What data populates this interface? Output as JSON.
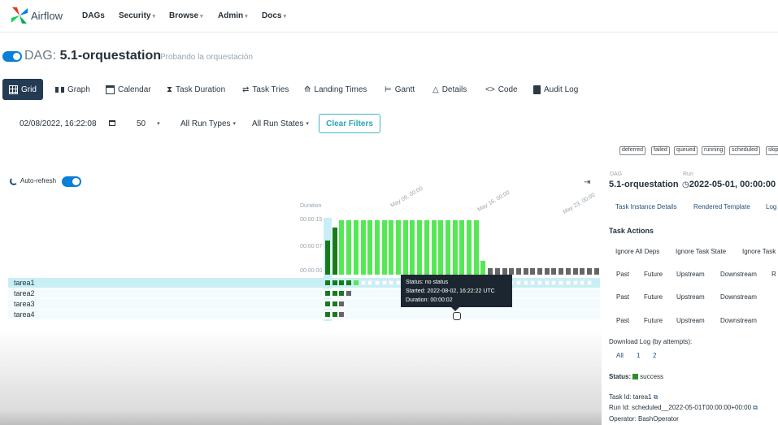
{
  "nav": {
    "brand": "Airflow",
    "items": [
      {
        "label": "DAGs",
        "has_menu": false
      },
      {
        "label": "Security",
        "has_menu": true
      },
      {
        "label": "Browse",
        "has_menu": true
      },
      {
        "label": "Admin",
        "has_menu": true
      },
      {
        "label": "Docs",
        "has_menu": true
      }
    ]
  },
  "dag": {
    "label": "DAG:",
    "name": "5.1-orquestation",
    "description": "Probando la orquestación",
    "paused": false
  },
  "tabs": [
    {
      "label": "Grid",
      "icon": "grid-icon",
      "active": true
    },
    {
      "label": "Graph",
      "icon": "graph-icon"
    },
    {
      "label": "Calendar",
      "icon": "calendar-icon"
    },
    {
      "label": "Task Duration",
      "icon": "hourglass-icon"
    },
    {
      "label": "Task Tries",
      "icon": "retry-icon"
    },
    {
      "label": "Landing Times",
      "icon": "landing-icon"
    },
    {
      "label": "Gantt",
      "icon": "gantt-icon"
    },
    {
      "label": "Details",
      "icon": "warning-icon"
    },
    {
      "label": "Code",
      "icon": "code-icon"
    },
    {
      "label": "Audit Log",
      "icon": "document-icon"
    }
  ],
  "filters": {
    "base_date": "02/08/2022, 16:22:08",
    "num_runs": "50",
    "run_types": "All Run Types",
    "run_states": "All Run States",
    "clear_label": "Clear Filters"
  },
  "legend": [
    {
      "label": "deferred",
      "color": "#8a4fc2"
    },
    {
      "label": "failed",
      "color": "#c0203a"
    },
    {
      "label": "queued",
      "color": "#7a7a7a"
    },
    {
      "label": "running",
      "color": "#55e855"
    },
    {
      "label": "scheduled",
      "color": "#c9b88a"
    },
    {
      "label": "skip",
      "color": "#e05fe0"
    }
  ],
  "grid": {
    "auto_refresh_label": "Auto-refresh",
    "auto_refresh_on": true,
    "duration_label": "Duration",
    "duration_ticks": [
      "00:00:15",
      "00:00:07",
      "00:00:00"
    ],
    "date_ticks": [
      "May 09, 00:00",
      "May 16, 00:00",
      "May 23, 00:00"
    ],
    "colors": {
      "success": "#1a7a1a",
      "running": "#55e855",
      "no_status": "#666666",
      "selected": "#c8eff6"
    },
    "runs": [
      {
        "duration": 0.6,
        "state": "success",
        "selected": true
      },
      {
        "duration": 0.83,
        "state": "success"
      },
      {
        "duration": 0.95,
        "state": "running"
      },
      {
        "duration": 0.95,
        "state": "running"
      },
      {
        "duration": 0.95,
        "state": "running"
      },
      {
        "duration": 0.95,
        "state": "running"
      },
      {
        "duration": 0.95,
        "state": "running"
      },
      {
        "duration": 0.95,
        "state": "running"
      },
      {
        "duration": 0.95,
        "state": "running"
      },
      {
        "duration": 0.95,
        "state": "running"
      },
      {
        "duration": 0.95,
        "state": "running"
      },
      {
        "duration": 0.95,
        "state": "running"
      },
      {
        "duration": 0.95,
        "state": "running"
      },
      {
        "duration": 0.95,
        "state": "running"
      },
      {
        "duration": 0.95,
        "state": "running"
      },
      {
        "duration": 0.95,
        "state": "running"
      },
      {
        "duration": 0.95,
        "state": "running"
      },
      {
        "duration": 0.95,
        "state": "running"
      },
      {
        "duration": 0.95,
        "state": "running"
      },
      {
        "duration": 0.95,
        "state": "running"
      },
      {
        "duration": 0.95,
        "state": "running"
      },
      {
        "duration": 0.95,
        "state": "running"
      },
      {
        "duration": 0.24,
        "state": "running"
      },
      {
        "duration": 0.12,
        "state": "no_status"
      },
      {
        "duration": 0.12,
        "state": "no_status"
      },
      {
        "duration": 0.12,
        "state": "no_status"
      },
      {
        "duration": 0.12,
        "state": "no_status"
      },
      {
        "duration": 0.12,
        "state": "no_status"
      },
      {
        "duration": 0.12,
        "state": "no_status"
      },
      {
        "duration": 0.12,
        "state": "no_status"
      },
      {
        "duration": 0.12,
        "state": "no_status"
      },
      {
        "duration": 0.12,
        "state": "no_status"
      },
      {
        "duration": 0.12,
        "state": "no_status"
      },
      {
        "duration": 0.12,
        "state": "no_status"
      },
      {
        "duration": 0.12,
        "state": "no_status"
      },
      {
        "duration": 0.12,
        "state": "no_status"
      },
      {
        "duration": 0.12,
        "state": "no_status"
      },
      {
        "duration": 0.12,
        "state": "no_status"
      },
      {
        "duration": 0.12,
        "state": "no_status"
      }
    ],
    "tasks": [
      {
        "name": "tarea1",
        "selected": true,
        "cells": [
          "success",
          "success",
          "success",
          "success",
          "running",
          "empty",
          "empty",
          "empty",
          "empty",
          "empty",
          "empty",
          "empty",
          "empty",
          "empty",
          "empty",
          "empty",
          "empty",
          "empty",
          "empty",
          "empty",
          "empty",
          "empty",
          "empty",
          "empty",
          "empty",
          "empty",
          "empty",
          "empty",
          "empty",
          "empty",
          "empty",
          "empty",
          "empty",
          "empty",
          "empty",
          "empty",
          "empty",
          "empty"
        ]
      },
      {
        "name": "tarea2",
        "cells": [
          "success",
          "success",
          "success",
          "no_status"
        ]
      },
      {
        "name": "tarea3",
        "cells": [
          "success",
          "success",
          "no_status"
        ]
      },
      {
        "name": "tarea4",
        "cells": [
          "success",
          "success",
          "no_status"
        ]
      }
    ]
  },
  "tooltip": {
    "status": "Status: no status",
    "started": "Started: 2022-08-02, 16:22:22 UTC",
    "duration": "Duration: 00:00:02"
  },
  "panel": {
    "dag_label": "DAG",
    "dag_name": "5.1-orquestation",
    "run_label": "Run",
    "run_name": "2022-05-01, 00:00:00",
    "links": [
      "Task Instance Details",
      "Rendered Template",
      "Log"
    ],
    "task_actions_title": "Task Actions",
    "action_row1": [
      "Ignore All Deps",
      "Ignore Task State",
      "Ignore Task"
    ],
    "action_row2": [
      "Past",
      "Future",
      "Upstream",
      "Downstream",
      "R"
    ],
    "action_row3": [
      "Past",
      "Future",
      "Upstream",
      "Downstream"
    ],
    "action_row4": [
      "Past",
      "Future",
      "Upstream",
      "Downstream"
    ],
    "download_log_title": "Download Log (by attempts):",
    "download_log_links": [
      "All",
      "1",
      "2"
    ],
    "status_label": "Status:",
    "status_value": "success",
    "task_id": "Task Id: tarea1",
    "run_id": "Run Id: scheduled__2022-05-01T00:00:00+00:00",
    "operator": "Operator: BashOperator"
  }
}
